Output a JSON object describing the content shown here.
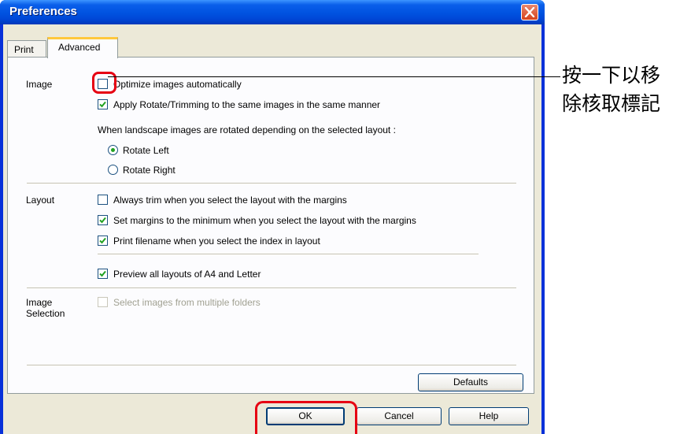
{
  "window": {
    "title": "Preferences"
  },
  "tabs": [
    {
      "label": "Print",
      "active": false
    },
    {
      "label": "Advanced",
      "active": true
    }
  ],
  "sections": {
    "image": {
      "label": "Image",
      "optimize": {
        "label": "Optimize images automatically",
        "checked": false
      },
      "apply_rotate": {
        "label": "Apply Rotate/Trimming to the same images in the same manner",
        "checked": true
      },
      "landscape_note": "When landscape images are rotated depending on the selected layout :",
      "rotate_left": {
        "label": "Rotate Left",
        "selected": true
      },
      "rotate_right": {
        "label": "Rotate Right",
        "selected": false
      }
    },
    "layout": {
      "label": "Layout",
      "always_trim": {
        "label": "Always trim when you select the layout with the margins",
        "checked": false
      },
      "set_margins": {
        "label": "Set margins to the minimum when you select the layout with the margins",
        "checked": true
      },
      "print_filename": {
        "label": "Print filename when you select the index in layout",
        "checked": true
      },
      "preview_all": {
        "label": "Preview all layouts of A4 and Letter",
        "checked": true
      }
    },
    "image_selection": {
      "label_line1": "Image",
      "label_line2": "Selection",
      "multiple_folders": {
        "label": "Select images from multiple folders",
        "checked": false,
        "enabled": false
      }
    }
  },
  "buttons": {
    "defaults": "Defaults",
    "ok": "OK",
    "cancel": "Cancel",
    "help": "Help"
  },
  "annotation": {
    "line1": "按一下以移",
    "line2": "除核取標記"
  },
  "colors": {
    "titlebar": "#0054e3",
    "highlight": "#e60012",
    "check": "#21a121",
    "dialog_bg": "#ece9d8"
  }
}
